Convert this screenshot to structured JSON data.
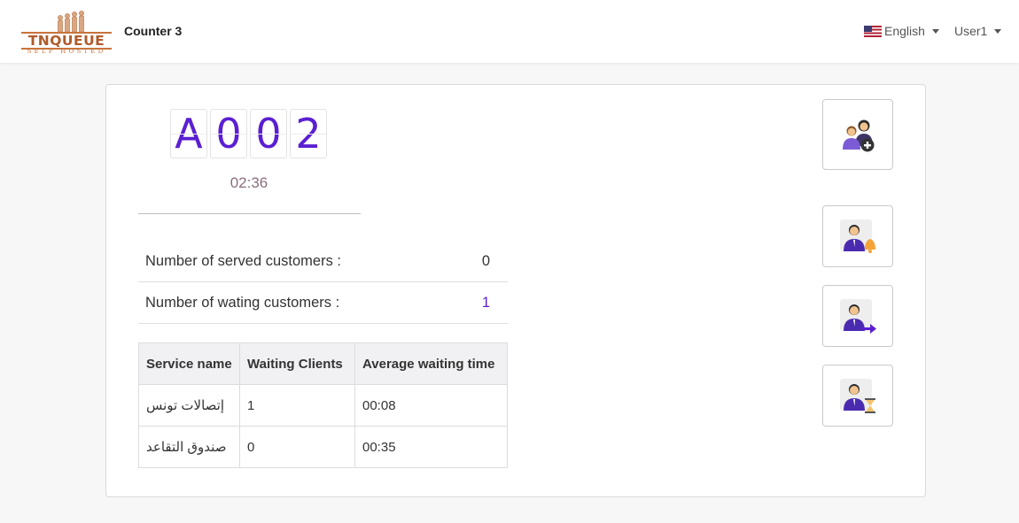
{
  "navbar": {
    "logo_text": "TNQUEUE",
    "logo_subtext": "SELF HOSTED",
    "counter_label": "Counter 3",
    "language": "English",
    "user": "User1"
  },
  "ticket": {
    "chars": [
      "A",
      "0",
      "0",
      "2"
    ],
    "timer": "02:36"
  },
  "stats": {
    "served_label": "Number of served customers :",
    "served_value": "0",
    "waiting_label": "Number of wating customers :",
    "waiting_value": "1"
  },
  "services_table": {
    "headers": [
      "Service name",
      "Waiting Clients",
      "Average waiting time"
    ],
    "rows": [
      [
        "إتصالات تونس",
        "1",
        "00:08"
      ],
      [
        "صندوق التقاعد",
        "0",
        "00:35"
      ]
    ]
  },
  "actions": {
    "icons": [
      "add-customer-icon",
      "call-customer-icon",
      "transfer-customer-icon",
      "waiting-customer-icon"
    ]
  },
  "colors": {
    "accent": "#5b1fd1",
    "logo": "#b05a2a",
    "timer": "#8b6d7d"
  }
}
